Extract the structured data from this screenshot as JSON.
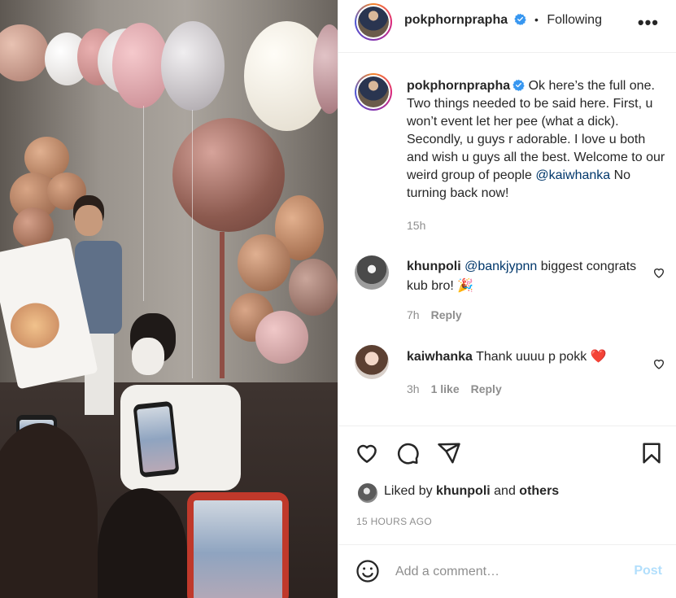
{
  "header": {
    "username": "pokphornprapha",
    "dot": "•",
    "follow_label": "Following",
    "more_label": "•••"
  },
  "caption": {
    "username": "pokphornprapha",
    "text_before": "Ok here’s the full one. Two things needed to be said here. First, u won’t event let her pee (what a dick). Secondly, u guys r adorable. I love u both and wish u guys all the best. Welcome to our weird group of people ",
    "mention": "@kaiwhanka",
    "text_after": " No turning back now!",
    "time": "15h"
  },
  "comments": [
    {
      "username": "khunpoli",
      "mention": "@bankjypnn",
      "text": " biggest congrats kub bro! 🎉",
      "time": "7h",
      "likes": "",
      "reply_label": "Reply"
    },
    {
      "username": "kaiwhanka",
      "mention": "",
      "text": "Thank uuuu p pokk ❤️",
      "time": "3h",
      "likes": "1 like",
      "reply_label": "Reply"
    }
  ],
  "likes": {
    "prefix": "Liked by ",
    "user": "khunpoli",
    "middle": " and ",
    "others": "others"
  },
  "timestamp": "15 HOURS AGO",
  "add_comment": {
    "placeholder": "Add a comment…",
    "post_label": "Post"
  },
  "colors": {
    "verified": "#3897f0",
    "mention": "#00376b",
    "muted": "#8e8e8e",
    "post_disabled": "#b2dffc",
    "heart_red": "#ed4956"
  },
  "icons": [
    "verified-badge-icon",
    "more-options-icon",
    "heart-icon",
    "comment-icon",
    "share-icon",
    "bookmark-icon",
    "emoji-icon",
    "like-comment-icon"
  ]
}
